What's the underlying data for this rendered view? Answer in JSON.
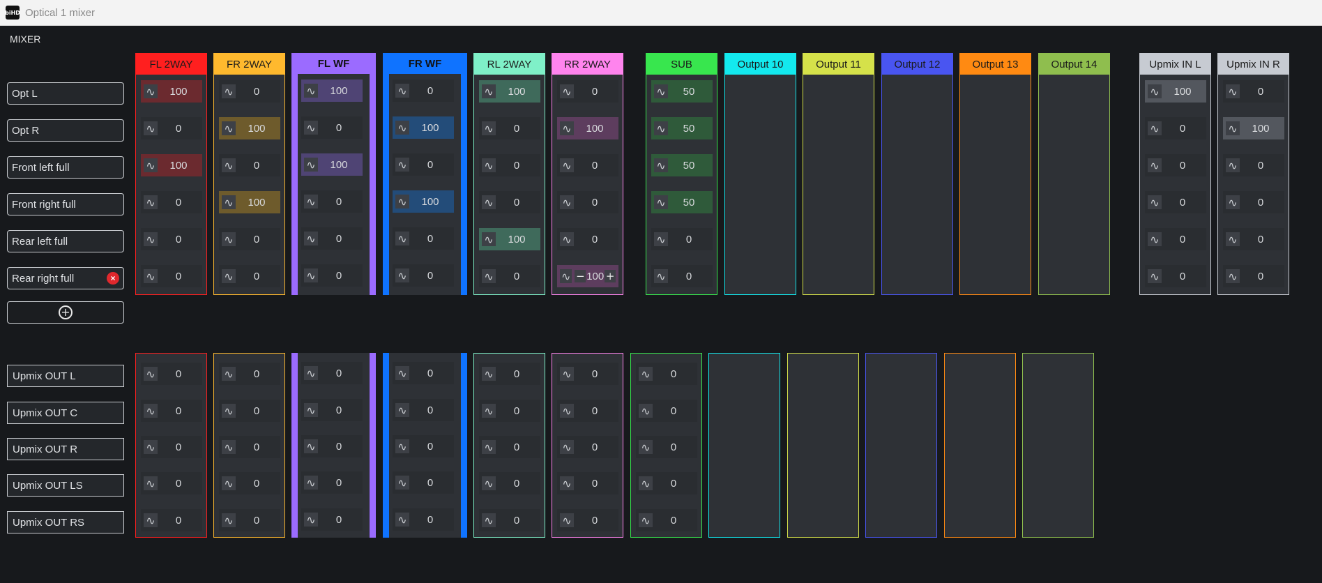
{
  "window": {
    "title": "Optical 1 mixer",
    "logo_text": "biHD"
  },
  "section_title": "MIXER",
  "input_rows": [
    "Opt L",
    "Opt R",
    "Front left full",
    "Front right full",
    "Rear left full",
    "Rear right full"
  ],
  "output_rows": [
    "Upmix OUT L",
    "Upmix OUT C",
    "Upmix OUT R",
    "Upmix OUT LS",
    "Upmix OUT RS"
  ],
  "icons": {
    "wave": "wave-icon",
    "remove": "remove-circle-icon",
    "add": "add-circle-icon",
    "minus": "minus-icon",
    "plus": "plus-icon"
  },
  "colors": {
    "background": "#17191c",
    "panel": "#2e3136",
    "cell": "#2a2d31",
    "label_border": "#c9ccd0",
    "remove": "#e0282d"
  },
  "editing_cell": {
    "column": "RR 2WAY",
    "row": "Rear right full",
    "value": "100"
  },
  "columns": [
    {
      "name": "FL 2WAY",
      "color": "#ff1f1f",
      "head_text": "#1a1a1a",
      "bold": false,
      "thick": false,
      "active": "#6b2a2f",
      "top": [
        "100",
        "0",
        "100",
        "0",
        "0",
        "0"
      ],
      "bottom": [
        "0",
        "0",
        "0",
        "0",
        "0"
      ]
    },
    {
      "name": "FR 2WAY",
      "color": "#ffb92e",
      "head_text": "#1a1a1a",
      "bold": false,
      "thick": false,
      "active": "#6e5b2c",
      "top": [
        "0",
        "100",
        "0",
        "100",
        "0",
        "0"
      ],
      "bottom": [
        "0",
        "0",
        "0",
        "0",
        "0"
      ]
    },
    {
      "name": "FL WF",
      "color": "#9b6bff",
      "head_text": "#111111",
      "bold": true,
      "thick": true,
      "active": "#4f4474",
      "top": [
        "100",
        "0",
        "100",
        "0",
        "0",
        "0"
      ],
      "bottom": [
        "0",
        "0",
        "0",
        "0",
        "0"
      ]
    },
    {
      "name": "FR WF",
      "color": "#0f73ff",
      "head_text": "#111111",
      "bold": true,
      "thick": true,
      "active": "#234c79",
      "top": [
        "0",
        "100",
        "0",
        "100",
        "0",
        "0"
      ],
      "bottom": [
        "0",
        "0",
        "0",
        "0",
        "0"
      ]
    },
    {
      "name": "RL 2WAY",
      "color": "#7ff0c8",
      "head_text": "#1a1a1a",
      "bold": false,
      "thick": false,
      "active": "#3f6a5b",
      "top": [
        "100",
        "0",
        "0",
        "0",
        "100",
        "0"
      ],
      "bottom": [
        "0",
        "0",
        "0",
        "0",
        "0"
      ]
    },
    {
      "name": "RR 2WAY",
      "color": "#ff84ee",
      "head_text": "#1a1a1a",
      "bold": false,
      "thick": false,
      "active": "#5d3d5e",
      "top": [
        "0",
        "100",
        "0",
        "0",
        "0",
        "100"
      ],
      "bottom": [
        "0",
        "0",
        "0",
        "0",
        "0"
      ]
    },
    {
      "name": "SUB",
      "color": "#38e64e",
      "head_text": "#1a1a1a",
      "bold": false,
      "thick": false,
      "active": "#2f5a3a",
      "top": [
        "50",
        "50",
        "50",
        "50",
        "0",
        "0"
      ],
      "bottom": [
        "0",
        "0",
        "0",
        "0",
        "0"
      ]
    },
    {
      "name": "Output 10",
      "color": "#13e9ee",
      "head_text": "#1a1a1a",
      "bold": false,
      "thick": false,
      "active": "#2a3a3a",
      "top": [],
      "bottom": []
    },
    {
      "name": "Output 11",
      "color": "#d5e14a",
      "head_text": "#1a1a1a",
      "bold": false,
      "thick": false,
      "active": "#3a3a2a",
      "top": [],
      "bottom": []
    },
    {
      "name": "Output 12",
      "color": "#4955f1",
      "head_text": "#1a1a1a",
      "bold": false,
      "thick": false,
      "active": "#2a2d4a",
      "top": [],
      "bottom": []
    },
    {
      "name": "Output 13",
      "color": "#ff8a12",
      "head_text": "#1a1a1a",
      "bold": false,
      "thick": false,
      "active": "#4a3a2a",
      "top": [],
      "bottom": []
    },
    {
      "name": "Output 14",
      "color": "#8fbe4e",
      "head_text": "#1a1a1a",
      "bold": false,
      "thick": false,
      "active": "#34422a",
      "top": [],
      "bottom": []
    },
    {
      "name": "Upmix IN L",
      "color": "#c7cbd2",
      "head_text": "#1a1a1a",
      "bold": false,
      "thick": false,
      "active": "#53575e",
      "top": [
        "100",
        "0",
        "0",
        "0",
        "0",
        "0"
      ],
      "bottom": null
    },
    {
      "name": "Upmix IN R",
      "color": "#c7cbd2",
      "head_text": "#1a1a1a",
      "bold": false,
      "thick": false,
      "active": "#53575e",
      "top": [
        "0",
        "100",
        "0",
        "0",
        "0",
        "0"
      ],
      "bottom": null
    }
  ]
}
